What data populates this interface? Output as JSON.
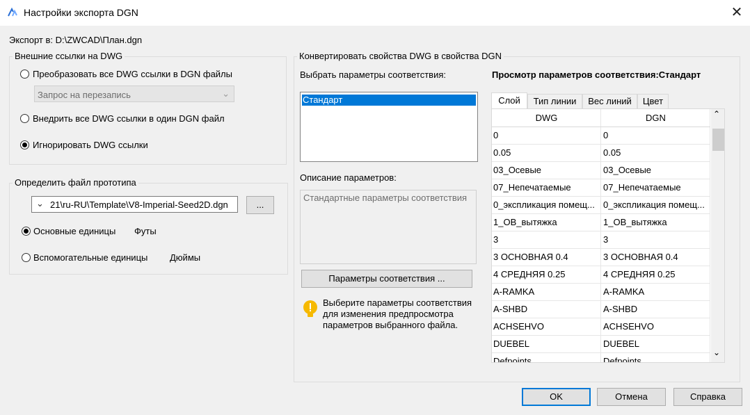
{
  "window": {
    "title": "Настройки экспорта DGN"
  },
  "export_to": "Экспорт в: D:\\ZWCAD\\План.dgn",
  "external_refs": {
    "legend": "Внешние ссылки на DWG",
    "options": [
      {
        "label": "Преобразовать все DWG ссылки в DGN файлы",
        "selected": false
      },
      {
        "label": "Внедрить все DWG ссылки в один DGN файл",
        "selected": false
      },
      {
        "label": "Игнорировать DWG ссылки",
        "selected": true
      }
    ],
    "overwrite_combo": "Запрос на перезапись"
  },
  "prototype": {
    "legend": "Определить файл прототипа",
    "file": "21\\ru-RU\\Template\\V8-Imperial-Seed2D.dgn",
    "browse_label": "...",
    "units": [
      {
        "label": "Основные единицы",
        "value": "Футы",
        "selected": true
      },
      {
        "label": "Вспомогательные единицы",
        "value": "Дюймы",
        "selected": false
      }
    ]
  },
  "convert": {
    "legend": "Конвертировать свойства DWG в свойства DGN",
    "select_label": "Выбрать параметры соответствия:",
    "mappings": [
      "Стандарт"
    ],
    "selected_mapping": "Стандарт",
    "description_label": "Описание параметров:",
    "description": "Стандартные параметры соответствия",
    "mapping_button": "Параметры соответствия ...",
    "hint": "Выберите параметры соответствия для изменения предпросмотра параметров выбранного файла.",
    "preview_title": "Просмотр параметров соответствия:Стандарт",
    "tabs": [
      "Слой",
      "Тип линии",
      "Вес линий",
      "Цвет"
    ],
    "active_tab": "Слой",
    "columns": [
      "DWG",
      "DGN"
    ],
    "rows": [
      [
        "0",
        "0"
      ],
      [
        "0.05",
        "0.05"
      ],
      [
        "03_Осевые",
        "03_Осевые"
      ],
      [
        "07_Непечатаемые",
        "07_Непечатаемые"
      ],
      [
        "0_экспликация помещ...",
        "0_экспликация помещ..."
      ],
      [
        "1_ОВ_вытяжка",
        "1_ОВ_вытяжка"
      ],
      [
        "3",
        "3"
      ],
      [
        "3 ОСНОВНАЯ 0.4",
        "3 ОСНОВНАЯ 0.4"
      ],
      [
        "4 СРЕДНЯЯ 0.25",
        "4 СРЕДНЯЯ 0.25"
      ],
      [
        "A-RAMKA",
        "A-RAMKA"
      ],
      [
        "A-SHBD",
        "A-SHBD"
      ],
      [
        "ACHSEHVO",
        "ACHSEHVO"
      ],
      [
        "DUEBEL",
        "DUEBEL"
      ],
      [
        "Defpoints",
        "Defpoints"
      ]
    ]
  },
  "buttons": {
    "ok": "OK",
    "cancel": "Отмена",
    "help": "Справка"
  },
  "colors": {
    "accent": "#0078d7",
    "hint_icon": "#f6b900"
  }
}
